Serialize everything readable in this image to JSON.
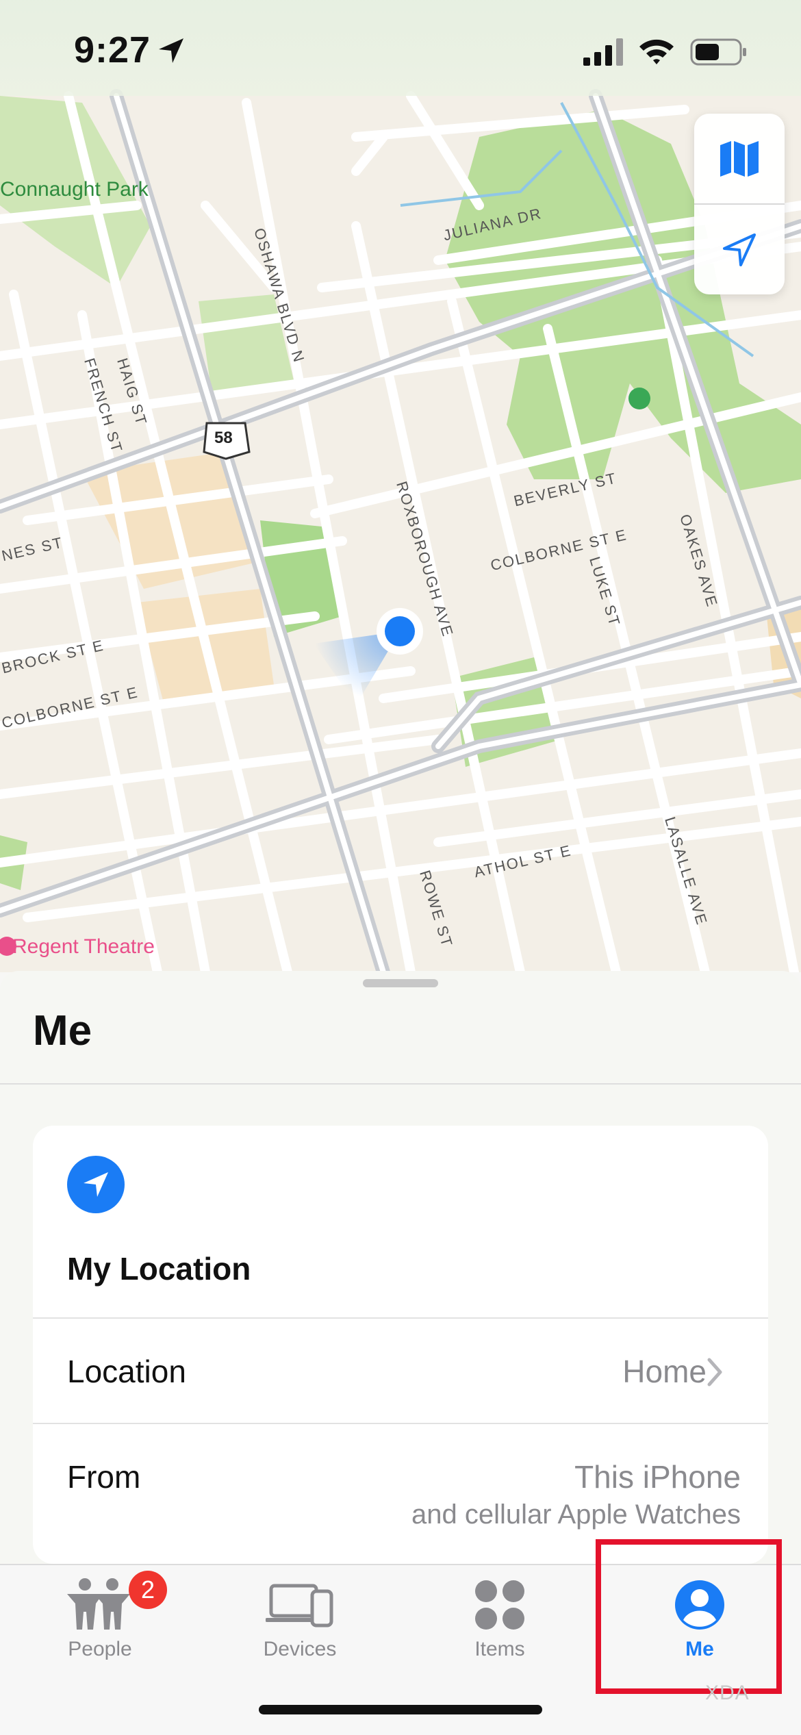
{
  "status_bar": {
    "time": "9:27"
  },
  "map": {
    "labels": {
      "connaught_park": "Connaught Park",
      "regent_theatre": "Regent Theatre",
      "juliana_dr": "JULIANA DR",
      "oshawa_blvd": "OSHAWA BLVD N",
      "french_st": "FRENCH ST",
      "haig_st": "HAIG ST",
      "route": "58",
      "beverly_st": "BEVERLY ST",
      "roxborough_ave": "ROXBOROUGH AVE",
      "colborne_st_e_1": "COLBORNE ST E",
      "luke_st": "LUKE ST",
      "oakes_ave": "OAKES AVE",
      "nes_st": "NES ST",
      "brock_st_e": "BROCK ST E",
      "colborne_st_e_2": "COLBORNE ST E",
      "athol_st_e": "ATHOL ST E",
      "rowe_st": "ROWE ST",
      "lasalle_ave": "LASALLE AVE"
    }
  },
  "sheet": {
    "title": "Me",
    "card": {
      "title": "My Location",
      "rows": [
        {
          "label": "Location",
          "value": "Home"
        },
        {
          "label": "From",
          "value": "This iPhone",
          "subvalue": "and cellular Apple Watches"
        }
      ]
    }
  },
  "tabs": [
    {
      "label": "People",
      "badge": "2",
      "active": false
    },
    {
      "label": "Devices",
      "active": false
    },
    {
      "label": "Items",
      "active": false
    },
    {
      "label": "Me",
      "active": true
    }
  ],
  "colors": {
    "accent": "#1a7cf5",
    "badge": "#f0352e",
    "highlight": "#e4122c"
  },
  "watermark": "XDA"
}
